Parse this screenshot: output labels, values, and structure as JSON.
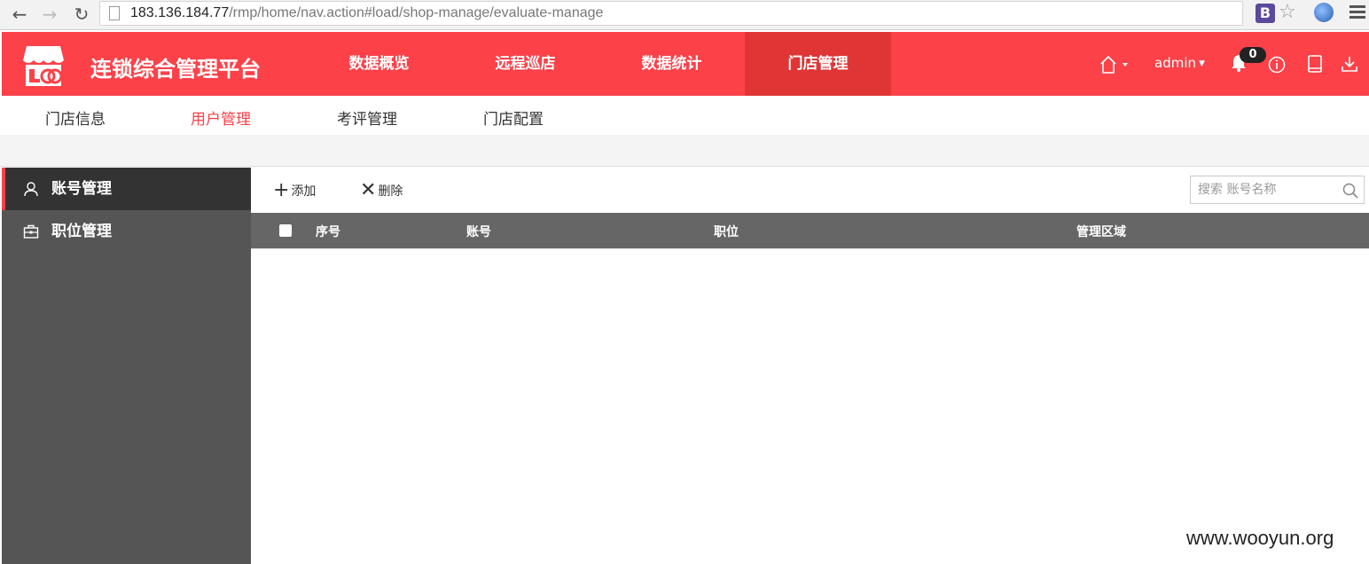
{
  "browser": {
    "url_host": "183.136.184.77",
    "url_path": "/rmp/home/nav.action#load/shop-manage/evaluate-manage",
    "extension_label": "B"
  },
  "header": {
    "title": "连锁综合管理平台",
    "nav": [
      {
        "label": "数据概览",
        "active": false
      },
      {
        "label": "远程巡店",
        "active": false
      },
      {
        "label": "数据统计",
        "active": false
      },
      {
        "label": "门店管理",
        "active": true
      }
    ],
    "user": "admin",
    "notification_count": "0",
    "brand_color": "#fc4149"
  },
  "sub_nav": {
    "items": [
      {
        "label": "门店信息",
        "active": false
      },
      {
        "label": "用户管理",
        "active": true
      },
      {
        "label": "考评管理",
        "active": false
      },
      {
        "label": "门店配置",
        "active": false
      }
    ]
  },
  "sidebar": {
    "items": [
      {
        "label": "账号管理",
        "icon": "user-icon",
        "active": true
      },
      {
        "label": "职位管理",
        "icon": "briefcase-icon",
        "active": false
      }
    ]
  },
  "toolbar": {
    "add_label": "添加",
    "delete_label": "删除",
    "search_placeholder": "搜索 账号名称"
  },
  "table": {
    "columns": [
      "序号",
      "账号",
      "职位",
      "管理区域"
    ],
    "rows": []
  },
  "watermark": "www.wooyun.org"
}
